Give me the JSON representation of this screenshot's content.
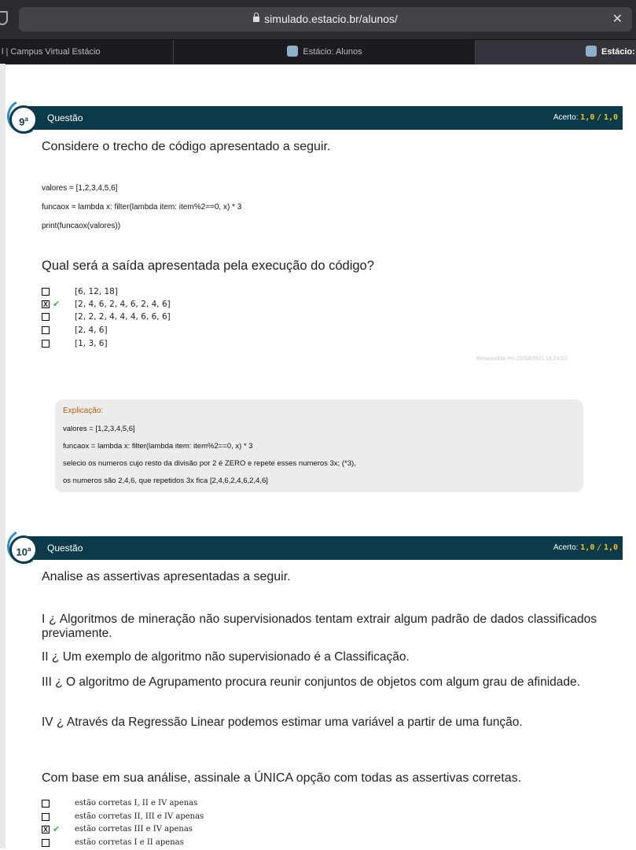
{
  "browser": {
    "url": "simulado.estacio.br/alunos/",
    "tabs": [
      "l | Campus Virtual Estácio",
      "Estácio: Alunos",
      "Estácio:"
    ]
  },
  "q9": {
    "number": "9",
    "ord": "a",
    "title": "Questão",
    "score_label": "Acerto:",
    "score": "1,0",
    "score_sep": "/",
    "score_max": "1,0",
    "intro": "Considere o trecho de código apresentado a seguir.",
    "code": [
      "valores = [1,2,3,4,5,6]",
      "funcaox = lambda x: filter(lambda item: item%2==0, x) * 3",
      "print(funcaox(valores))"
    ],
    "question": "Qual será a saída apresentada pela execução do código?",
    "options": [
      "[6, 12, 18]",
      "[2, 4, 6, 2, 4, 6, 2, 4, 6]",
      "[2, 2, 2, 4, 4, 4, 6, 6, 6]",
      "[2, 4, 6]",
      "[1, 3, 6]"
    ],
    "selected_index": 1,
    "answered": "Respondido em 22/04/2021 18:24:53",
    "explanation": {
      "head": "Explicação:",
      "lines": [
        "valores = [1,2,3,4,5,6]",
        "funcaox = lambda x: filter(lambda item: item%2==0, x) * 3",
        "selecio os numeros cujo resto da divisão por 2 é ZERO e repete esses numeros 3x;  (*3),",
        "os numeros são 2,4,6, que repetidos 3x fica [2,4,6,2,4,6,2,4,6]"
      ]
    }
  },
  "q10": {
    "number": "10",
    "ord": "a",
    "title": "Questão",
    "score_label": "Acerto:",
    "score": "1,0",
    "score_sep": "/",
    "score_max": "1,0",
    "intro": "Analise as assertivas apresentadas a seguir.",
    "assertions": [
      "I ¿ Algoritmos de mineração não supervisionados tentam extrair algum padrão de dados classificados previamente.",
      "II ¿ Um exemplo de algoritmo não supervisionado é a Classificação.",
      "III ¿ O algoritmo de Agrupamento procura reunir conjuntos de objetos com algum grau de afinidade.",
      "IV ¿ Através da Regressão Linear podemos estimar uma variável a partir de uma função."
    ],
    "question": "Com base em sua análise, assinale a ÚNICA opção com todas as assertivas corretas.",
    "options": [
      "estão corretas I, II e IV apenas",
      "estão corretas II, III e IV apenas",
      "estão corretas III e IV apenas",
      "estão corretas I e II apenas"
    ],
    "selected_index": 2
  },
  "marks": {
    "selected": "X",
    "correct": "✔"
  },
  "colors": {
    "header_bar": "#0b3a4a",
    "score": "#f5c518",
    "correct": "#3cb043",
    "explain_head": "#b25f00"
  }
}
